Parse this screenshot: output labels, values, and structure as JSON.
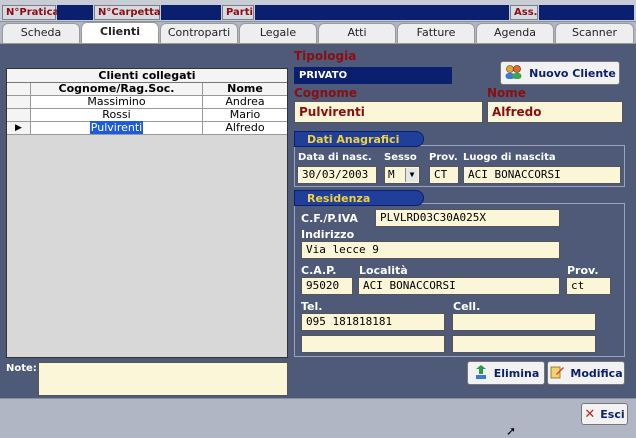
{
  "topbar": {
    "pratica_label": "N°Pratica",
    "carpetta_label": "N°Carpetta",
    "parti_label": "Parti",
    "ass_label": "Ass."
  },
  "tabs": [
    {
      "label": "Scheda"
    },
    {
      "label": "Clienti"
    },
    {
      "label": "Controparti"
    },
    {
      "label": "Legale"
    },
    {
      "label": "Atti"
    },
    {
      "label": "Fatture"
    },
    {
      "label": "Agenda"
    },
    {
      "label": "Scanner"
    }
  ],
  "clients_table": {
    "caption": "Clienti collegati",
    "columns": [
      "Cognome/Rag.Soc.",
      "Nome"
    ],
    "rows": [
      {
        "cognome": "Massimino",
        "nome": "Andrea"
      },
      {
        "cognome": "Rossi",
        "nome": "Mario"
      },
      {
        "cognome": "Pulvirenti",
        "nome": "Alfredo"
      }
    ]
  },
  "note": {
    "label": "Note:",
    "value": ""
  },
  "form": {
    "tipologia_label": "Tipologia",
    "tipologia_value": "PRIVATO",
    "nuovo_cliente": "Nuovo Cliente",
    "cognome_label": "Cognome",
    "cognome_value": "Pulvirenti",
    "nome_label": "Nome",
    "nome_value": "Alfredo",
    "dati_anagrafici": "Dati Anagrafici",
    "data_nasc_label": "Data di nasc.",
    "data_nasc_value": "30/03/2003",
    "sesso_label": "Sesso",
    "sesso_value": "M",
    "prov_label": "Prov.",
    "prov_nascita_value": "CT",
    "luogo_label": "Luogo di nascita",
    "luogo_value": "ACI BONACCORSI",
    "residenza": "Residenza",
    "cf_label": "C.F./P.IVA",
    "cf_value": "PLVLRD03C30A025X",
    "indirizzo_label": "Indirizzo",
    "indirizzo_value": "Via lecce 9",
    "cap_label": "C.A.P.",
    "cap_value": "95020",
    "localita_label": "Località",
    "localita_value": "ACI BONACCORSI",
    "prov_res_label": "Prov.",
    "prov_res_value": "ct",
    "tel_label": "Tel.",
    "tel_value": "095 181818181",
    "tel2_value": "",
    "cell_label": "Cell.",
    "cell_value": "",
    "cell2_value": ""
  },
  "buttons": {
    "elimina": "Elimina",
    "modifica": "Modifica",
    "esci": "Esci"
  },
  "colors": {
    "panel": "#4e5a78",
    "label_red": "#8b0d10",
    "field_bg": "#fbf6d8",
    "navy": "#0a1f6e"
  }
}
